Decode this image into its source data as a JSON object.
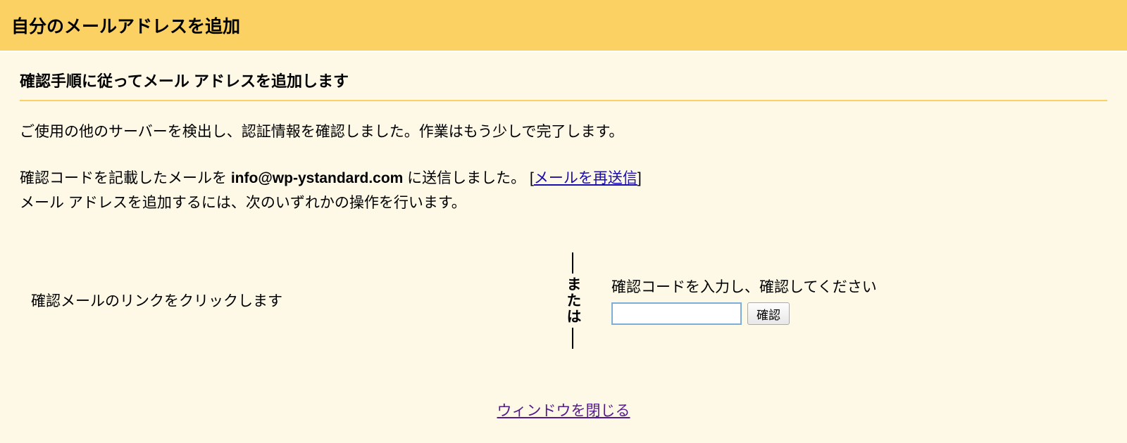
{
  "header": {
    "title": "自分のメールアドレスを追加"
  },
  "content": {
    "subtitle": "確認手順に従ってメール アドレスを追加します",
    "info_text": "ご使用の他のサーバーを検出し、認証情報を確認しました。作業はもう少しで完了します。",
    "confirmation": {
      "prefix": "確認コードを記載したメールを ",
      "email": "info@wp-ystandard.com",
      "suffix": " に送信しました。 ",
      "bracket_open": "[",
      "resend_link": "メールを再送信",
      "bracket_close": "]",
      "instruction": "メール アドレスを追加するには、次のいずれかの操作を行います。"
    },
    "options": {
      "left_text": "確認メールのリンクをクリックします",
      "divider_label": "または",
      "right_label": "確認コードを入力し、確認してください",
      "confirm_button": "確認"
    },
    "close_link": "ウィンドウを閉じる"
  }
}
